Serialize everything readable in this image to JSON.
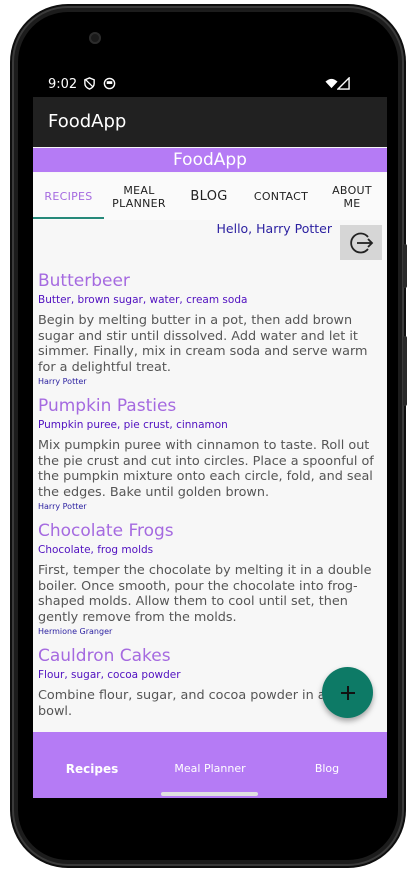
{
  "status_bar": {
    "time": "9:02",
    "icons": [
      "shield-icon",
      "face-icon",
      "wifi-icon",
      "signal-icon"
    ]
  },
  "app_bar": {
    "title": "FoodApp"
  },
  "banner": {
    "title": "FoodApp"
  },
  "tabs": [
    {
      "label": "RECIPES",
      "active": true
    },
    {
      "label": "MEAL PLANNER",
      "active": false
    },
    {
      "label": "BLOG",
      "active": false
    },
    {
      "label": "CONTACT",
      "active": false
    },
    {
      "label": "ABOUT ME",
      "active": false
    }
  ],
  "greeting": "Hello, Harry Potter",
  "logout_icon": "logout-icon",
  "recipes": [
    {
      "name": "Butterbeer",
      "ingredients": "Butter, brown sugar, water, cream soda",
      "steps": "Begin by melting butter in a pot, then add brown sugar and stir until dissolved. Add water and let it simmer. Finally, mix in cream soda and serve warm for a delightful treat.",
      "author": "Harry Potter"
    },
    {
      "name": "Pumpkin Pasties",
      "ingredients": "Pumpkin puree, pie crust, cinnamon",
      "steps": "Mix pumpkin puree with cinnamon to taste. Roll out the pie crust and cut into circles. Place a spoonful of the pumpkin mixture onto each circle, fold, and seal the edges. Bake until golden brown.",
      "author": "Harry Potter"
    },
    {
      "name": "Chocolate Frogs",
      "ingredients": "Chocolate, frog molds",
      "steps": "First, temper the chocolate by melting it in a double boiler. Once smooth, pour the chocolate into frog-shaped molds. Allow them to cool until set, then gently remove from the molds.",
      "author": "Hermione Granger"
    },
    {
      "name": "Cauldron Cakes",
      "ingredients": "Flour, sugar, cocoa powder",
      "steps": "Combine flour, sugar, and cocoa powder in a mixing bowl.",
      "author": ""
    }
  ],
  "fab": {
    "icon": "plus-icon"
  },
  "bottom_nav": [
    {
      "label": "Recipes",
      "active": true
    },
    {
      "label": "Meal Planner",
      "active": false
    },
    {
      "label": "Blog",
      "active": false
    }
  ],
  "colors": {
    "accent_purple": "#b57bf5",
    "title_purple": "#a56ae0",
    "fab_teal": "#0d7a66",
    "tab_indicator": "#26897a",
    "app_bar": "#212121"
  }
}
